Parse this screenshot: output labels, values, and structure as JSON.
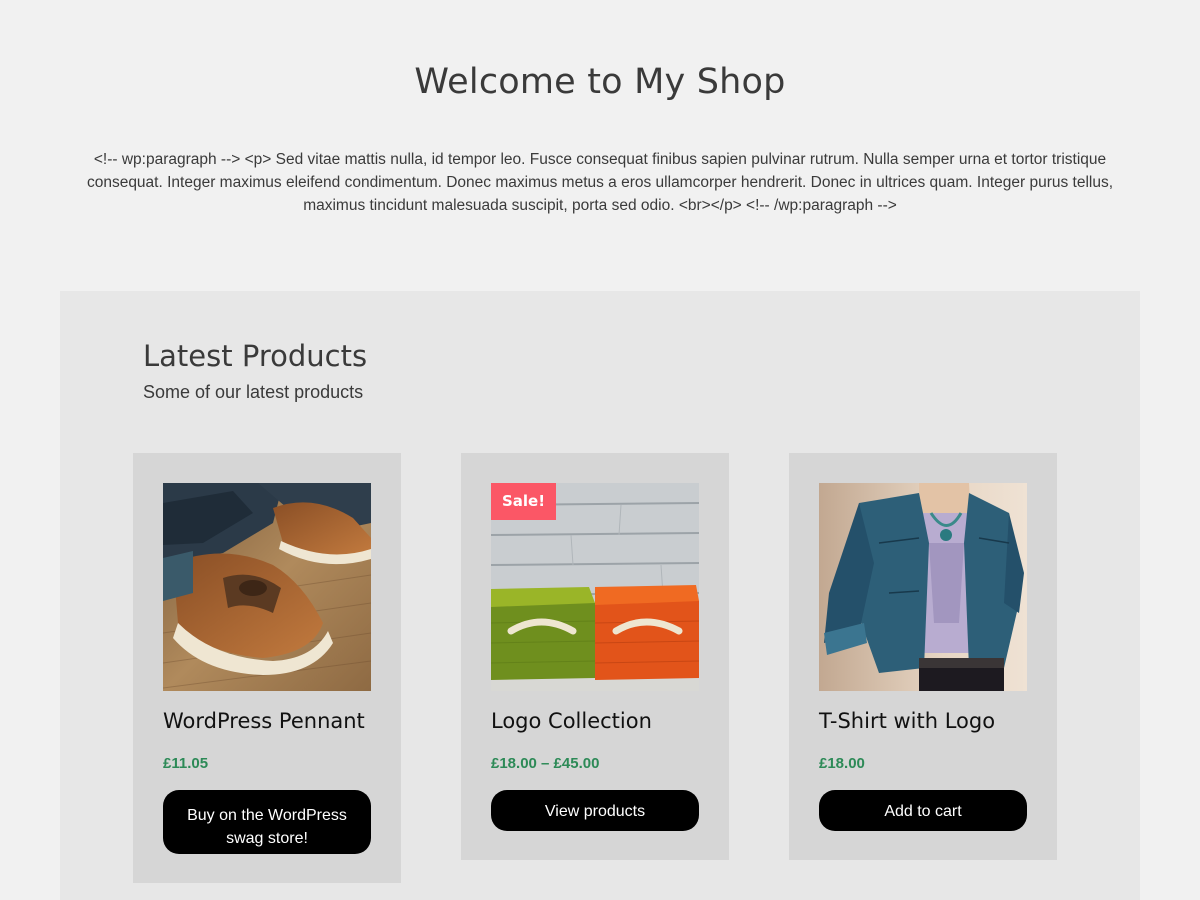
{
  "page": {
    "title": "Welcome to My Shop",
    "intro": "<!-- wp:paragraph --> <p> Sed vitae mattis nulla, id tempor leo. Fusce consequat finibus sapien pulvinar rutrum. Nulla semper urna et tortor tristique consequat. Integer maximus eleifend condimentum. Donec maximus metus a eros ullamcorper hendrerit. Donec in ultrices quam. Integer purus tellus, maximus tincidunt malesuada suscipit, porta sed odio. <br></p> <!-- /wp:paragraph -->"
  },
  "latest": {
    "title": "Latest Products",
    "subtitle": "Some of our latest products",
    "products": [
      {
        "name": "WordPress Pennant",
        "price": "£11.05",
        "button": "Buy on the WordPress swag store!",
        "image": "shoes-photo"
      },
      {
        "name": "Logo Collection",
        "price": "£18.00 – £45.00",
        "button": "View products",
        "badge": "Sale!",
        "image": "baskets-photo"
      },
      {
        "name": "T-Shirt with Logo",
        "price": "£18.00",
        "button": "Add to cart",
        "image": "jacket-photo"
      }
    ]
  },
  "colors": {
    "page_bg": "#f1f1f1",
    "panel_bg": "#e7e7e7",
    "card_bg": "#d6d6d6",
    "price": "#2d8a57",
    "button_bg": "#000000",
    "sale_badge": "#fb5766"
  }
}
